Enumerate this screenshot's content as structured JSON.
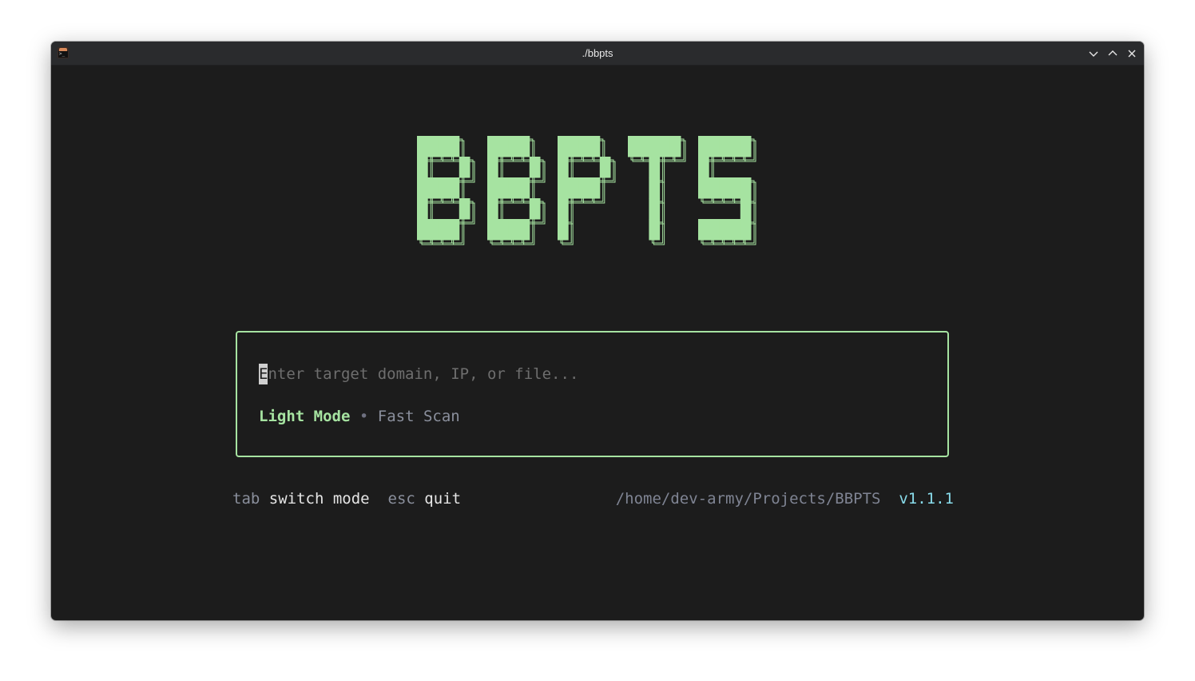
{
  "window": {
    "title": "./bbpts",
    "app_icon": "terminal-icon",
    "controls": [
      "minimize-icon",
      "maximize-icon",
      "close-icon"
    ]
  },
  "logo": {
    "text": "BBPTS",
    "color": "#a6e3a1"
  },
  "input": {
    "cursor_char": "E",
    "placeholder_rest": "nter target domain, IP, or file..."
  },
  "mode": {
    "active": "Light Mode",
    "separator": "•",
    "description": "Fast Scan"
  },
  "status": {
    "hints": [
      {
        "key": "tab",
        "action": "switch mode"
      },
      {
        "key": "esc",
        "action": "quit"
      }
    ],
    "path": "/home/dev-army/Projects/BBPTS",
    "version": "v1.1.1"
  },
  "colors": {
    "background": "#1c1c1c",
    "accent": "#a6e3a1",
    "version": "#89dceb",
    "muted": "#8a8f9c"
  }
}
